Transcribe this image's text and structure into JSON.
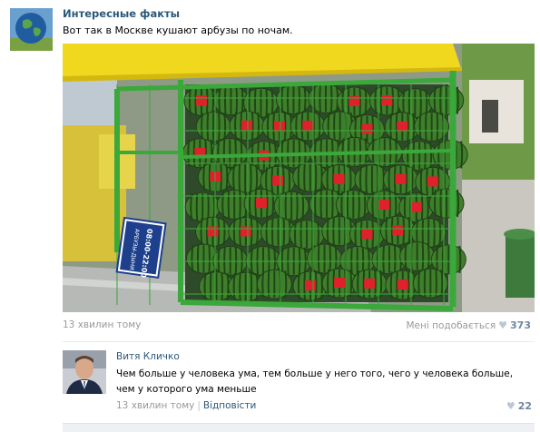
{
  "post": {
    "author": "Интересные факты",
    "text": "Вот так в Москве кушают арбузы по ночам.",
    "time": "13 хвилин тому",
    "likes_label": "Мені подобається",
    "likes_count": "373",
    "avatar_icon": "globe-icon",
    "photo": {
      "sign_text_line1": "АРБУЗЫ-ДЫНИ",
      "sign_text_line2": "08:00-22:00"
    }
  },
  "comment": {
    "author": "Витя Кличко",
    "text": "Чем больше у человека ума, тем больше у него того, чего у человека больше, чем у которого ума меньше",
    "time": "13 хвилин тому",
    "separator": "|",
    "reply_label": "Відповісти",
    "likes_count": "22"
  },
  "icons": {
    "heart": "♥"
  },
  "colors": {
    "link": "#2b587a",
    "muted": "#999999",
    "like_icon": "#bac7d5",
    "cage_green": "#3aa83a",
    "awning_yellow": "#f2dc1a"
  }
}
